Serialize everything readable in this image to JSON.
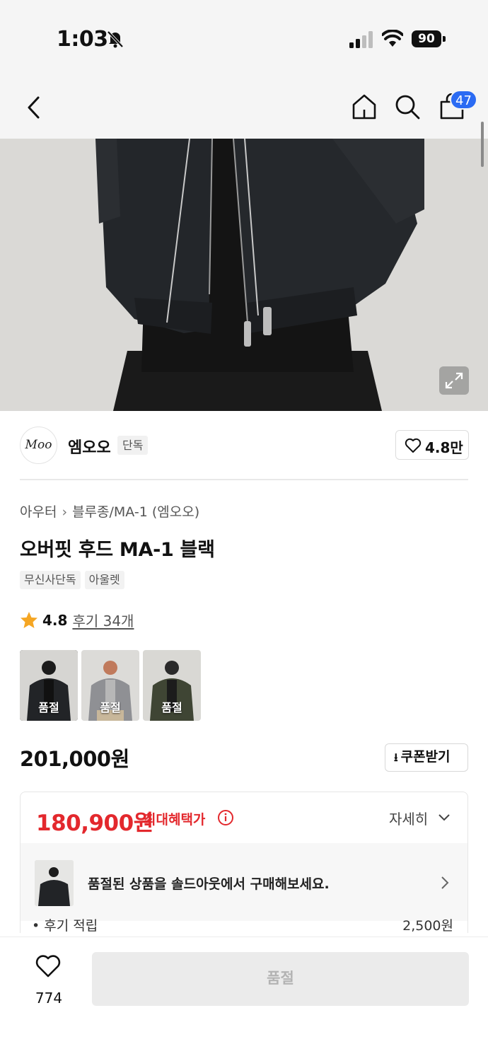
{
  "status_bar": {
    "time": "1:03",
    "battery": "90"
  },
  "nav": {
    "cart_count": "47"
  },
  "brand": {
    "logo_text": "Moo",
    "name": "엠오오",
    "tag": "단독",
    "likes": "4.8만"
  },
  "product": {
    "breadcrumb": [
      "아우터",
      "블루종/MA-1 (엠오오)"
    ],
    "title": "오버핏 후드 MA-1 블랙",
    "tags": [
      "무신사단독",
      "아울렛"
    ],
    "rating": "4.8",
    "reviews": "후기 34개"
  },
  "thumbnails": [
    {
      "label": "품절",
      "color": "black"
    },
    {
      "label": "품절",
      "color": "gray"
    },
    {
      "label": "품절",
      "color": "khaki"
    }
  ],
  "price": {
    "original": "201,000원",
    "coupon_label": "쿠폰받기"
  },
  "benefit": {
    "max_price": "180,900원",
    "max_label": "최대혜택가",
    "detail_label": "자세히",
    "soldout_message": "품절된 상품을 솔드아웃에서 구매해보세요.",
    "clipped_left": "• 후기 적립",
    "clipped_right": "2,500원"
  },
  "bottom": {
    "wish_count": "774",
    "buy_label": "품절"
  },
  "colors": {
    "accent_red": "#e3282d",
    "badge_blue": "#2b6bf3"
  }
}
